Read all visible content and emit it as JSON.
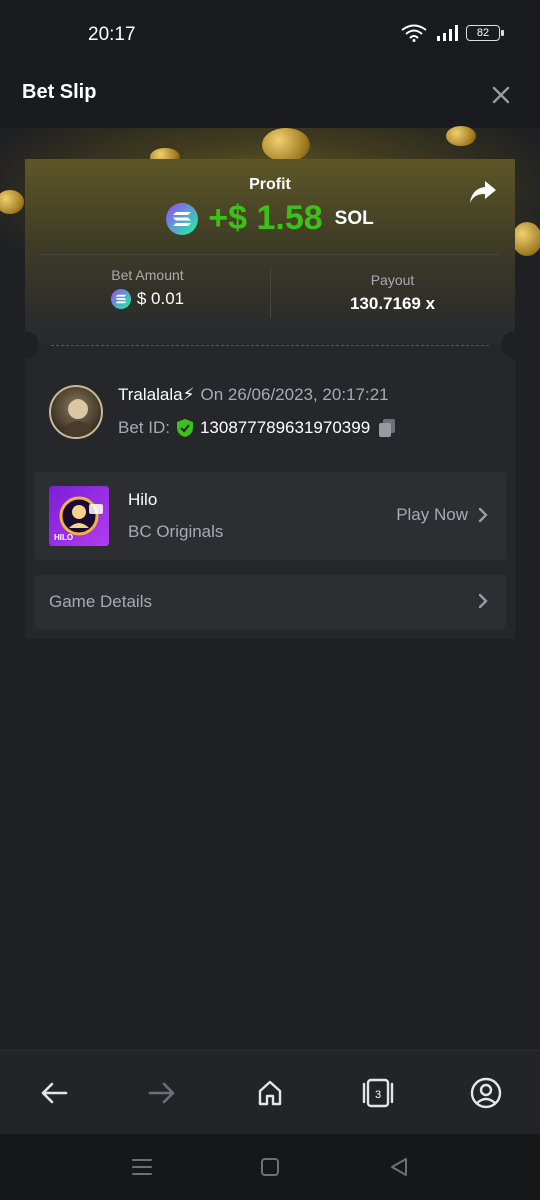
{
  "status_bar": {
    "time": "20:17",
    "battery": "82"
  },
  "header": {
    "title": "Bet Slip"
  },
  "profit": {
    "label": "Profit",
    "amount": "+$ 1.58",
    "currency": "SOL",
    "color": "#3bc117"
  },
  "bet_amount": {
    "label": "Bet Amount",
    "value": "$ 0.01",
    "icon": "solana-icon"
  },
  "payout": {
    "label": "Payout",
    "value": "130.7169 x"
  },
  "user": {
    "name": "Tralalala⚡",
    "date": "On 26/06/2023, 20:17:21",
    "bet_id_label": "Bet ID:",
    "bet_id": "130877789631970399"
  },
  "game": {
    "name": "Hilo",
    "provider": "BC Originals",
    "thumb_label": "HILO",
    "action": "Play Now"
  },
  "details": {
    "label": "Game Details"
  },
  "bottom_nav": {
    "tab_count": "3"
  }
}
